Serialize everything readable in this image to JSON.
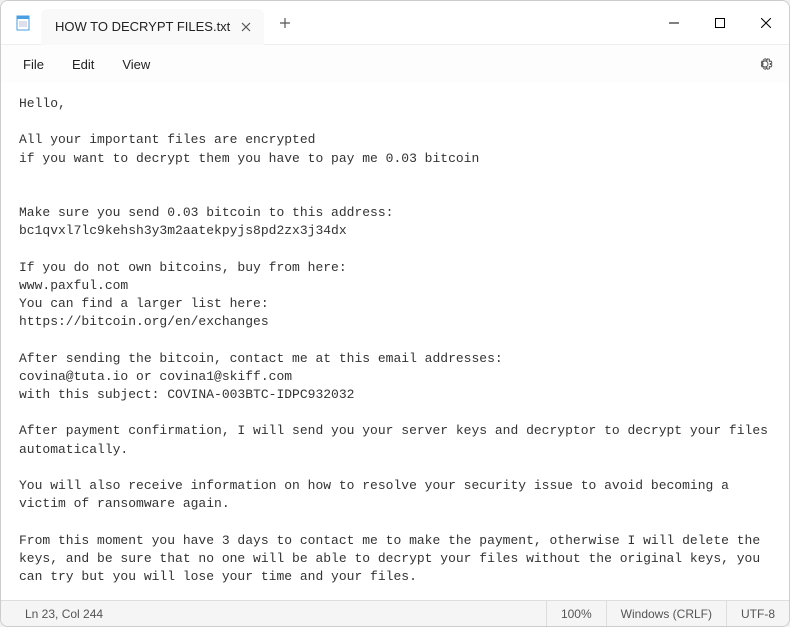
{
  "tab": {
    "title": "HOW TO DECRYPT FILES.txt"
  },
  "menu": {
    "file": "File",
    "edit": "Edit",
    "view": "View"
  },
  "content": "Hello,\n\nAll your important files are encrypted\nif you want to decrypt them you have to pay me 0.03 bitcoin\n\n\nMake sure you send 0.03 bitcoin to this address:\nbc1qvxl7lc9kehsh3y3m2aatekpyjs8pd2zx3j34dx\n\nIf you do not own bitcoins, buy from here:\nwww.paxful.com\nYou can find a larger list here:\nhttps://bitcoin.org/en/exchanges\n\nAfter sending the bitcoin, contact me at this email addresses:\ncovina@tuta.io or covina1@skiff.com\nwith this subject: COVINA-003BTC-IDPC932032\n\nAfter payment confirmation, I will send you your server keys and decryptor to decrypt your files automatically.\n\nYou will also receive information on how to resolve your security issue to avoid becoming a victim of ransomware again.\n\nFrom this moment you have 3 days to contact me to make the payment, otherwise I will delete the keys, and be sure that no one will be able to decrypt your files without the original keys, you can try but you will lose your time and your files.",
  "statusbar": {
    "position": "Ln 23, Col 244",
    "zoom": "100%",
    "line_ending": "Windows (CRLF)",
    "encoding": "UTF-8"
  }
}
